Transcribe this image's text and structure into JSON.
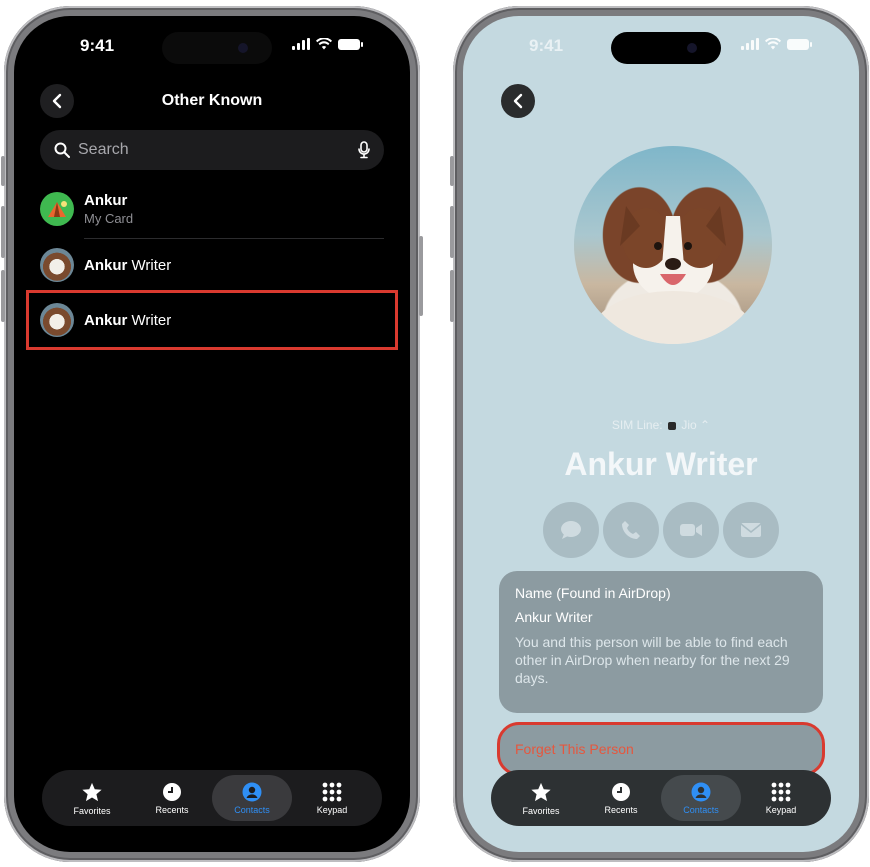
{
  "status": {
    "time": "9:41"
  },
  "left_screen": {
    "nav_title": "Other Known",
    "search": {
      "placeholder": "Search"
    },
    "contacts": [
      {
        "first": "Ankur",
        "rest": "",
        "subtitle": "My Card"
      },
      {
        "first": "Ankur",
        "rest": " Writer",
        "subtitle": ""
      },
      {
        "first": "Ankur",
        "rest": " Writer",
        "subtitle": ""
      }
    ]
  },
  "right_screen": {
    "sim_line": {
      "label": "SIM Line:",
      "carrier": "Jio"
    },
    "contact_name": "Ankur Writer",
    "card": {
      "title": "Name (Found in AirDrop)",
      "value": "Ankur Writer",
      "description": "You and this person will be able to find each other in AirDrop when nearby for the next 29 days."
    },
    "forget_label": "Forget This Person"
  },
  "tabbar": {
    "tabs": [
      {
        "label": "Favorites",
        "icon": "star-icon"
      },
      {
        "label": "Recents",
        "icon": "clock-icon"
      },
      {
        "label": "Contacts",
        "icon": "person-icon"
      },
      {
        "label": "Keypad",
        "icon": "keypad-icon"
      }
    ],
    "active": "Contacts"
  },
  "colors": {
    "active_tab": "#2f8ff5",
    "highlight": "#d93a2f",
    "destructive": "#e5573e"
  }
}
